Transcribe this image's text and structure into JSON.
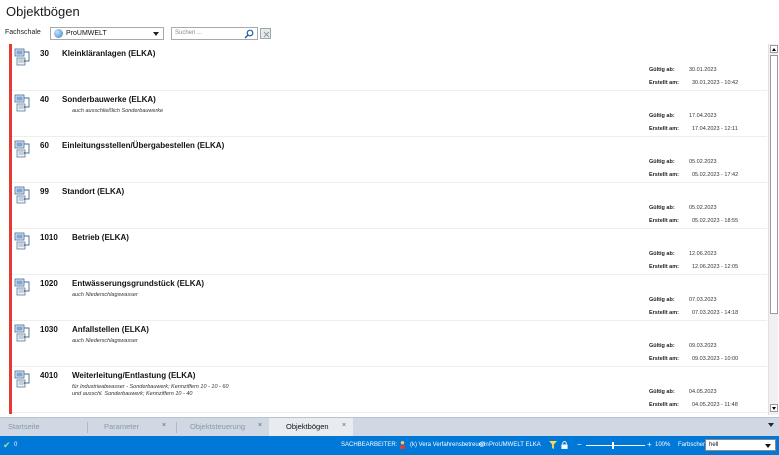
{
  "window": {
    "title": "Objektbögen"
  },
  "toolbar": {
    "fachschale_label": "Fachschale",
    "fachschale_value": "ProUMWELT",
    "search_placeholder": "Suchen ..."
  },
  "items": [
    {
      "num": "30",
      "name": "Kleinkläranlagen (ELKA)",
      "desc": [],
      "gueltig_label": "Gültig ab:",
      "gueltig": "30.01.2023",
      "erstellt_label": "Erstellt am:",
      "erstellt": "30.01.2023 - 10:42"
    },
    {
      "num": "40",
      "name": "Sonderbauwerke (ELKA)",
      "desc": [
        "auch ausschließlich Sonderbauwerke"
      ],
      "gueltig_label": "Gültig ab:",
      "gueltig": "17.04.2023",
      "erstellt_label": "Erstellt am:",
      "erstellt": "17.04.2023 - 12:11"
    },
    {
      "num": "60",
      "name": "Einleitungsstellen/Übergabestellen (ELKA)",
      "desc": [],
      "gueltig_label": "Gültig ab:",
      "gueltig": "05.02.2023",
      "erstellt_label": "Erstellt am:",
      "erstellt": "05.02.2023 - 17:42"
    },
    {
      "num": "99",
      "name": "Standort (ELKA)",
      "desc": [],
      "gueltig_label": "Gültig ab:",
      "gueltig": "05.02.2023",
      "erstellt_label": "Erstellt am:",
      "erstellt": "05.02.2023 - 18:55"
    },
    {
      "num": "1010",
      "name": "Betrieb (ELKA)",
      "desc": [],
      "gueltig_label": "Gültig ab:",
      "gueltig": "12.06.2023",
      "erstellt_label": "Erstellt am:",
      "erstellt": "12.06.2023 - 12:05"
    },
    {
      "num": "1020",
      "name": "Entwässerungsgrundstück (ELKA)",
      "desc": [
        "auch Niederschlagswasser"
      ],
      "gueltig_label": "Gültig ab:",
      "gueltig": "07.03.2023",
      "erstellt_label": "Erstellt am:",
      "erstellt": "07.03.2023 - 14:18"
    },
    {
      "num": "1030",
      "name": "Anfallstellen (ELKA)",
      "desc": [
        "auch Niederschlagswasser"
      ],
      "gueltig_label": "Gültig ab:",
      "gueltig": "09.03.2023",
      "erstellt_label": "Erstellt am:",
      "erstellt": "09.03.2023 - 10:00"
    },
    {
      "num": "4010",
      "name": "Weiterleitung/Entlastung (ELKA)",
      "desc": [
        "für Industrieabwasser - Sonderbauwerk; Kennziffern 10 - 10 - 60",
        "und ausschl. Sonderbauwerk; Kennziffern 10 - 40"
      ],
      "gueltig_label": "Gültig ab:",
      "gueltig": "04.05.2023",
      "erstellt_label": "Erstellt am:",
      "erstellt": "04.05.2023 - 11:48"
    }
  ],
  "tabs": [
    {
      "label": "Startseite",
      "close": ""
    },
    {
      "label": "Parameter",
      "close": "×"
    },
    {
      "label": "Objektsteuerung",
      "close": "×"
    },
    {
      "label": "Objektbögen",
      "close": "×"
    }
  ],
  "status": {
    "count": "0",
    "sachbearbeiter_label": "SACHBEARBEITER:",
    "user": "(k) Vera Verfahrensbetreuerin",
    "module": "ProUMWELT ELKA",
    "zoom_minus": "−",
    "zoom_plus": "+",
    "zoom": "100%",
    "farbschema_label": "Farbschema",
    "farbschema_value": "hell"
  },
  "colors": {
    "accent_red": "#e53935",
    "status_blue": "#0078d7",
    "tab_bar": "#cfd8e3"
  }
}
